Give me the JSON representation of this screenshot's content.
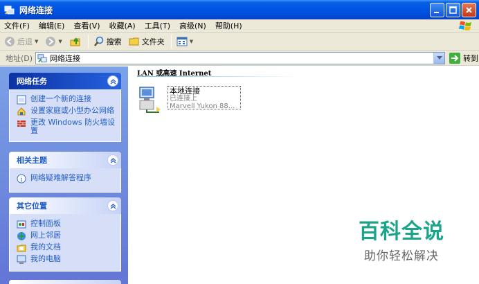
{
  "window": {
    "title": "网络连接"
  },
  "menu": [
    "文件(F)",
    "编辑(E)",
    "查看(V)",
    "收藏(A)",
    "工具(T)",
    "高级(N)",
    "帮助(H)"
  ],
  "toolbar": {
    "back": "后退",
    "search": "搜索",
    "folders": "文件夹"
  },
  "address": {
    "label": "地址(D)",
    "value": "网络连接",
    "go": "转到"
  },
  "sidebar": {
    "panels": [
      {
        "title": "网络任务",
        "items": [
          "创建一个新的连接",
          "设置家庭或小型办公网络",
          "更改 Windows 防火墙设置"
        ]
      },
      {
        "title": "相关主题",
        "items": [
          "网络疑难解答程序"
        ]
      },
      {
        "title": "其它位置",
        "items": [
          "控制面板",
          "网上邻居",
          "我的文档",
          "我的电脑"
        ]
      }
    ]
  },
  "main": {
    "group_title": "LAN 或高速 Internet",
    "connection": {
      "name": "本地连接",
      "status": "已连接上",
      "device": "Marvell Yukon 88..."
    }
  },
  "watermark": {
    "title": "百科全说",
    "subtitle": "助你轻松解决"
  },
  "colors": {
    "titlebar": "#0055e3",
    "sidebar": "#7ba2e7",
    "panel_body": "#d6dff7",
    "link": "#215dc6",
    "watermark": "#1aa58a"
  }
}
